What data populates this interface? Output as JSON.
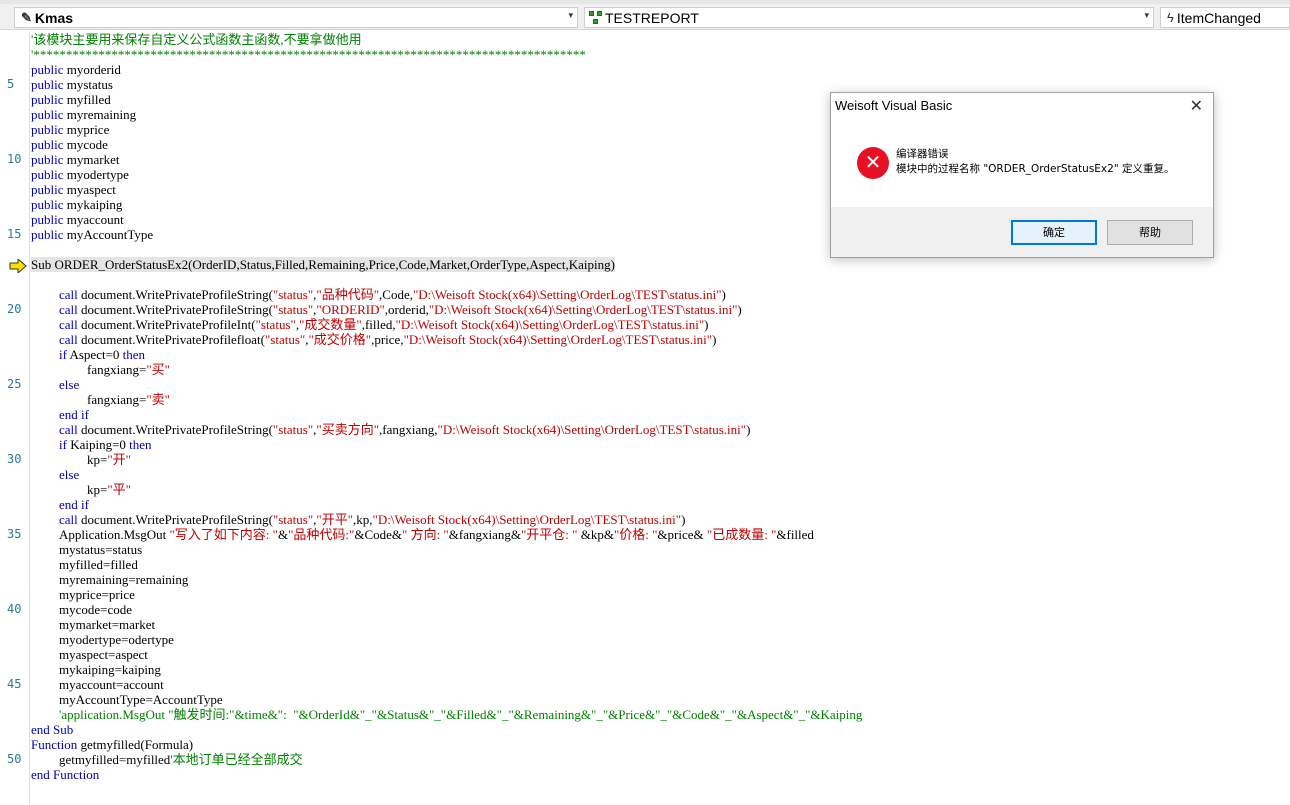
{
  "toolbar": {
    "object_combo": "Kmas",
    "procedure_combo": "TESTREPORT",
    "event_combo": "ItemChanged",
    "dropdown_glyph": "▾"
  },
  "gutter": {
    "line_numbers": [
      "5",
      "10",
      "15",
      "20",
      "25",
      "30",
      "35",
      "40",
      "45",
      "50"
    ]
  },
  "code": {
    "l1": "'该模块主要用来保存自定义公式函数主函数,不要拿做他用",
    "l2": "'*************************************************************************************",
    "pub_kw": "public",
    "vars": [
      "myorderid",
      "mystatus",
      "myfilled",
      "myremaining",
      "myprice",
      "mycode",
      "mymarket",
      "myodertype",
      "myaspect",
      "mykaiping",
      "myaccount",
      "myAccountType"
    ],
    "sub_line": "Sub ORDER_OrderStatusEx2(OrderID,Status,Filled,Remaining,Price,Code,Market,OrderType,Aspect,Kaiping)",
    "call_kw": "call",
    "c1_a": " document.WritePrivateProfileString(",
    "c1_s1": "\"status\"",
    "c1_comma": ",",
    "c1_s2": "\"品种代码\"",
    "c1_b": ",Code,",
    "c1_s3": "\"D:\\Weisoft Stock(x64)\\Setting\\OrderLog\\TEST\\status.ini\"",
    "close_paren": ")",
    "c2_s2": "\"ORDERID\"",
    "c2_b": ",orderid,",
    "c3_a": " document.WritePrivateProfileInt(",
    "c3_s2": "\"成交数量\"",
    "c3_b": ",filled,",
    "c4_a": " document.WritePrivateProfilefloat(",
    "c4_s2": "\"成交价格\"",
    "c4_b": ",price,",
    "if_kw": "if",
    "then_kw": "then",
    "if1_cond": " Aspect=0 ",
    "fx_a": "fangxiang=",
    "fx_buy": "\"买\"",
    "else_kw": "else",
    "fx_sell": "\"卖\"",
    "endif_kw": "end if",
    "c5_s2": "\"买卖方向\"",
    "c5_b": ",fangxiang,",
    "if2_cond": " Kaiping=0 ",
    "kp_a": "kp=",
    "kp_open": "\"开\"",
    "kp_flat": "\"平\"",
    "c6_s2": "\"开平\"",
    "c6_b": ",kp,",
    "msg_a": "Application.MsgOut ",
    "msg_s1": "\"写入了如下内容: \"",
    "msg_b": "&",
    "msg_s2": "\"品种代码:\"",
    "msg_c": "&Code&",
    "msg_s3": "\" 方向: \"",
    "msg_d": "&fangxiang&",
    "msg_s4": "\"开平仓: \"",
    "msg_e": " &kp&",
    "msg_s5": "\"价格: \"",
    "msg_f": "&price& ",
    "msg_s6": "\"已成数量: \"",
    "msg_g": "&filled",
    "assigns": [
      "mystatus=status",
      "myfilled=filled",
      "myremaining=remaining",
      "myprice=price",
      "mycode=code",
      "mymarket=market",
      "myodertype=odertype",
      "myaspect=aspect",
      "mykaiping=kaiping",
      "myaccount=account",
      "myAccountType=AccountType"
    ],
    "comment_msg": "'application.MsgOut \"触发时间:\"&time&\":  \"&OrderId&\"_\"&Status&\"_\"&Filled&\"_\"&Remaining&\"_\"&Price&\"_\"&Code&\"_\"&Aspect&\"_\"&Kaiping",
    "endsub_kw": "end Sub",
    "func_kw": "Function",
    "func_rest": " getmyfilled(Formula)",
    "getmy": "getmyfilled=myfilled",
    "getmy_cm": "'本地订单已经全部成交",
    "endfunc_kw": "end Function"
  },
  "dialog": {
    "title": "Weisoft Visual Basic",
    "close_glyph": "✕",
    "error_glyph": "✕",
    "message_title": "编译器错误",
    "message_body": "模块中的过程名称 \"ORDER_OrderStatusEx2\" 定义重复。",
    "ok_label": "确定",
    "help_label": "帮助"
  },
  "colors": {
    "keyword": "#0000c0",
    "string": "#c00000",
    "comment": "#008000",
    "error_icon": "#e81123",
    "exec_arrow": "#ffe100"
  }
}
